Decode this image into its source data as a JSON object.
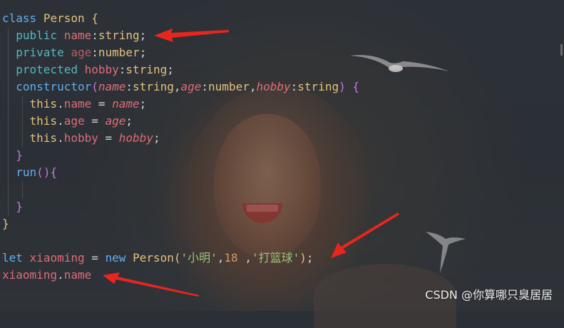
{
  "code": {
    "lines": [
      {
        "t1": "class",
        "t2": " ",
        "t3": "Person",
        "t4": " ",
        "t5": "{"
      },
      {
        "t1": "public",
        "t2": " ",
        "t3": "name",
        "t4": ":",
        "t5": "string",
        "t6": ";"
      },
      {
        "t1": "private",
        "t2": " ",
        "t3": "age",
        "t4": ":",
        "t5": "number",
        "t6": ";"
      },
      {
        "t1": "protected",
        "t2": " ",
        "t3": "hobby",
        "t4": ":",
        "t5": "string",
        "t6": ";"
      },
      {
        "t1": "constructor",
        "t2": "(",
        "t3": "name",
        "t4": ":",
        "t5": "string",
        "t6": ",",
        "t7": "age",
        "t8": ":",
        "t9": "number",
        "t10": ",",
        "t11": "hobby",
        "t12": ":",
        "t13": "string",
        "t14": ")",
        "t15": " ",
        "t16": "{"
      },
      {
        "t1": "this",
        "t2": ".",
        "t3": "name",
        "t4": " = ",
        "t5": "name",
        "t6": ";"
      },
      {
        "t1": "this",
        "t2": ".",
        "t3": "age",
        "t4": " = ",
        "t5": "age",
        "t6": ";"
      },
      {
        "t1": "this",
        "t2": ".",
        "t3": "hobby",
        "t4": " = ",
        "t5": "hobby",
        "t6": ";"
      },
      {
        "t1": "}"
      },
      {
        "t1": "run",
        "t2": "(",
        "t3": ")",
        "t4": "{"
      },
      {
        "t1": ""
      },
      {
        "t1": "}"
      },
      {
        "t1": "}"
      },
      {
        "t1": ""
      },
      {
        "t1": "let",
        "t2": " ",
        "t3": "xiaoming",
        "t4": " = ",
        "t5": "new",
        "t6": " ",
        "t7": "Person",
        "t8": "(",
        "t9": "'小明'",
        "t10": ",",
        "t11": "18",
        "t12": " ,",
        "t13": "'打篮球'",
        "t14": ")",
        "t15": ";"
      },
      {
        "t1": "xiaoming",
        "t2": ".",
        "t3": "name"
      }
    ]
  },
  "watermark": "CSDN @你算哪只臭居居",
  "colors": {
    "annotation_arrow": "#e8251f",
    "background": "#2b2f36"
  },
  "icons": [
    "seagull-icon"
  ]
}
